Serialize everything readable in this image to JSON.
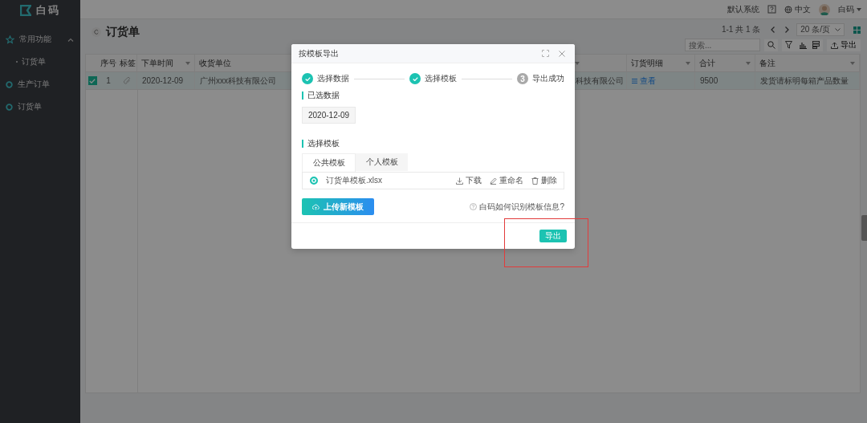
{
  "sidebar": {
    "logo": "白码",
    "items": [
      {
        "label": "常用功能",
        "expanded": true,
        "children": [
          {
            "label": "订货单"
          }
        ]
      },
      {
        "label": "生产订单"
      },
      {
        "label": "订货单"
      }
    ]
  },
  "top_bar": {
    "system": "默认系统",
    "language": "中文",
    "user": "白码"
  },
  "page": {
    "title": "订货单",
    "pagination": "1-1 共 1 条",
    "page_size": "20 条/页",
    "search": {
      "placeholder": "搜索..."
    },
    "export_button": "导出"
  },
  "table": {
    "columns": [
      {
        "label": "序号",
        "sortable": false
      },
      {
        "label": "标签",
        "sortable": false
      },
      {
        "label": "下单时间",
        "sortable": true
      },
      {
        "label": "收货单位",
        "sortable": false
      },
      {
        "sortable": true
      },
      {
        "label": "订货明细",
        "sortable": true
      },
      {
        "label": "合计",
        "sortable": true
      },
      {
        "label": "备注",
        "sortable": true
      }
    ],
    "rows": [
      {
        "selected": true,
        "cells": [
          {
            "kind": "text",
            "text": "1"
          },
          {
            "kind": "tag"
          },
          {
            "kind": "text",
            "text": "2020-12-09"
          },
          {
            "kind": "text",
            "text": "广州xxx科技有限公司"
          },
          {
            "kind": "text",
            "text": "科技有限公司"
          },
          {
            "kind": "link",
            "text": "查看"
          },
          {
            "kind": "text",
            "text": "9500"
          },
          {
            "kind": "text",
            "text": "发货请标明每箱产品数量"
          }
        ]
      }
    ]
  },
  "dialog": {
    "title": "按模板导出",
    "steps": [
      {
        "label": "选择数据",
        "done": true
      },
      {
        "label": "选择模板",
        "done": true
      },
      {
        "label": "导出成功",
        "done": false,
        "number": "3"
      }
    ],
    "selected_data": {
      "heading": "已选数据",
      "value": "2020-12-09"
    },
    "template_section": {
      "heading": "选择模板",
      "tabs": [
        {
          "label": "公共模板",
          "selected": true
        },
        {
          "label": "个人模板",
          "selected": false
        }
      ],
      "templates": [
        {
          "name": "订货单模板.xlsx",
          "selected": true,
          "actions": [
            {
              "kind": "download",
              "label": "下载"
            },
            {
              "kind": "rename",
              "label": "重命名"
            },
            {
              "kind": "delete",
              "label": "删除"
            }
          ]
        }
      ]
    },
    "upload_button": "上传新模板",
    "help_link": "白码如何识别模板信息?",
    "export_button": "导出"
  }
}
